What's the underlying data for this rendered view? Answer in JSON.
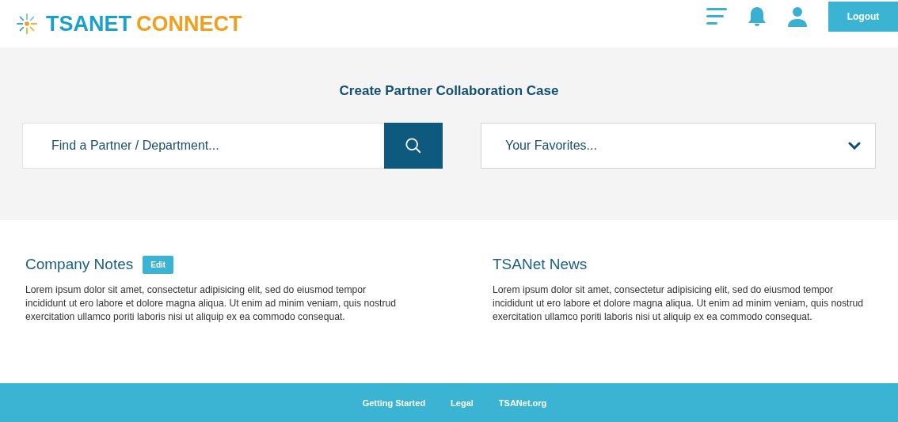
{
  "logo": {
    "brand": "TSANET",
    "product": "CONNECT"
  },
  "header": {
    "logout": "Logout"
  },
  "create_case": {
    "title": "Create Partner Collaboration Case",
    "search": {
      "placeholder": "Find a Partner / Department..."
    },
    "favorites": {
      "placeholder": "Your Favorites..."
    }
  },
  "sections": [
    {
      "title": "Company Notes",
      "edit": "Edit",
      "text": "Lorem ipsum dolor sit amet, consectetur adipisicing elit, sed do eiusmod tempor incididunt ut ero labore et dolore magna aliqua. Ut enim ad minim veniam, quis nostrud exercitation ullamco poriti laboris nisi ut aliquip ex ea commodo consequat."
    },
    {
      "title": "TSANet News",
      "text": "Lorem ipsum dolor sit amet, consectetur adipisicing elit, sed do eiusmod tempor incididunt ut ero labore et dolore magna aliqua. Ut enim ad minim veniam, quis nostrud exercitation ullamco poriti laboris nisi ut aliquip ex ea commodo consequat."
    }
  ],
  "footer": {
    "links": [
      "Getting Started",
      "Legal",
      "TSANet.org"
    ]
  }
}
